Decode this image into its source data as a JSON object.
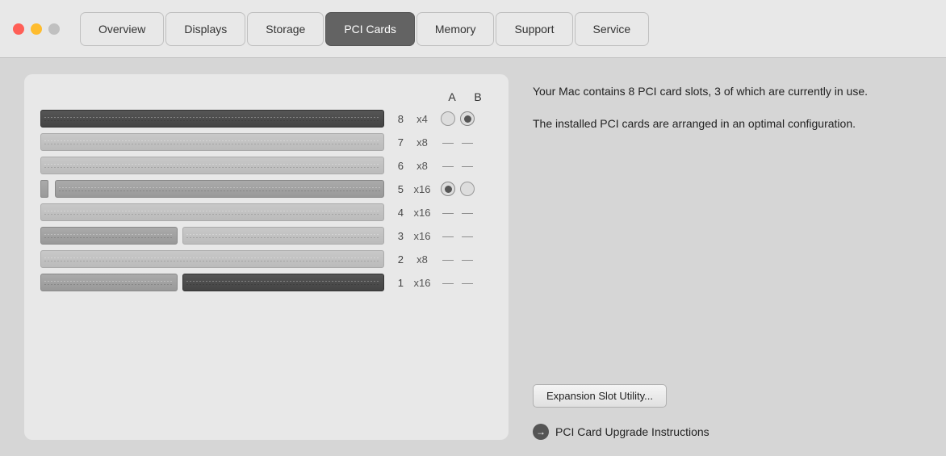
{
  "window": {
    "buttons": {
      "close": "●",
      "minimize": "●",
      "maximize": "●"
    }
  },
  "tabs": [
    {
      "id": "overview",
      "label": "Overview",
      "active": false
    },
    {
      "id": "displays",
      "label": "Displays",
      "active": false
    },
    {
      "id": "storage",
      "label": "Storage",
      "active": false
    },
    {
      "id": "pci-cards",
      "label": "PCI Cards",
      "active": true
    },
    {
      "id": "memory",
      "label": "Memory",
      "active": false
    },
    {
      "id": "support",
      "label": "Support",
      "active": false
    },
    {
      "id": "service",
      "label": "Service",
      "active": false
    }
  ],
  "column_headers": {
    "a": "A",
    "b": "B"
  },
  "slots": [
    {
      "num": "8",
      "speed": "x4",
      "a": "radio",
      "b": "radio-filled",
      "card": "dark",
      "has_left": false
    },
    {
      "num": "7",
      "speed": "x8",
      "a": "dash",
      "b": "dash",
      "card": "light",
      "has_left": false
    },
    {
      "num": "6",
      "speed": "x8",
      "a": "dash",
      "b": "dash",
      "card": "light",
      "has_left": false
    },
    {
      "num": "5",
      "speed": "x16",
      "a": "radio-filled",
      "b": "radio",
      "card": "medium",
      "has_left": false
    },
    {
      "num": "4",
      "speed": "x16",
      "a": "dash",
      "b": "dash",
      "card": "light",
      "has_left": false
    },
    {
      "num": "3",
      "speed": "x16",
      "a": "dash",
      "b": "dash",
      "card": "light",
      "has_left": true
    },
    {
      "num": "2",
      "speed": "x8",
      "a": "dash",
      "b": "dash",
      "card": "light",
      "has_left": false
    },
    {
      "num": "1",
      "speed": "x16",
      "a": "dash",
      "b": "dash",
      "card": "dark",
      "has_left": true
    }
  ],
  "info": {
    "description1": "Your Mac contains 8 PCI card slots, 3 of which are currently in use.",
    "description2": "The installed PCI cards are arranged in an optimal configuration."
  },
  "buttons": {
    "expansion_utility": "Expansion Slot Utility...",
    "upgrade_instructions": "PCI Card Upgrade Instructions"
  }
}
